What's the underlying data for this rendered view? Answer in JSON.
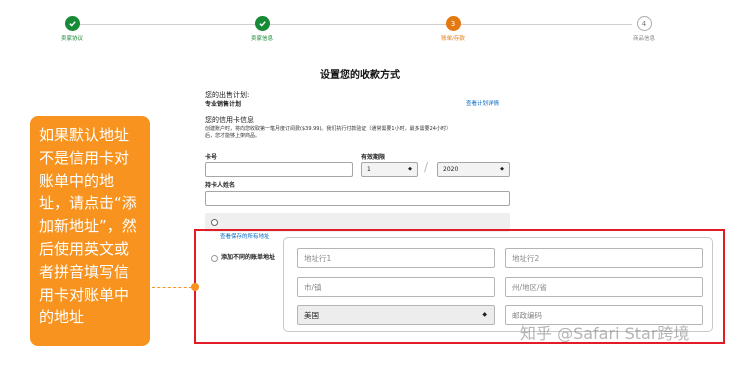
{
  "steps": [
    {
      "label": "卖家协议",
      "state": "done",
      "num": ""
    },
    {
      "label": "卖家信息",
      "state": "done",
      "num": ""
    },
    {
      "label": "账单/存款",
      "state": "current",
      "num": "3"
    },
    {
      "label": "商品信息",
      "state": "pending",
      "num": "4"
    }
  ],
  "page": {
    "title": "设置您的收款方式",
    "plan_heading": "您的出售计划:",
    "plan_value": "专业销售计划",
    "plan_link": "查看计划详情",
    "card_heading": "您的信用卡信息",
    "card_note_1": "创建账户时，将向您收取第一笔月度订阅费($39.99)。我们执行付款验证（通常需要1小时，最多需要24小时）",
    "card_note_2": "后，您才能够上架商品。"
  },
  "form": {
    "card_number_label": "卡号",
    "expiry_label": "有效期限",
    "expiry_month": "1",
    "expiry_year": "2020",
    "holder_label": "持卡人姓名",
    "view_addresses_link": "查看保存的所有地址",
    "add_address_label": "添加不同的账单地址"
  },
  "address": {
    "line1_placeholder": "地址行1",
    "line2_placeholder": "地址行2",
    "city_placeholder": "市/镇",
    "state_placeholder": "州/地区/省",
    "country": "美国",
    "zip_placeholder": "邮政编码"
  },
  "annotation": {
    "text": "如果默认地址不是信用卡对账单中的地址，请点击“添加新地址”，然后使用英文或者拼音填写信用卡对账单中的地址",
    "accent": "#f7931e",
    "frame_color": "#e21c24"
  },
  "watermark": "知乎 @Safari Star跨境",
  "colors": {
    "done": "#168a35",
    "current": "#e47911",
    "link": "#0066c0"
  }
}
